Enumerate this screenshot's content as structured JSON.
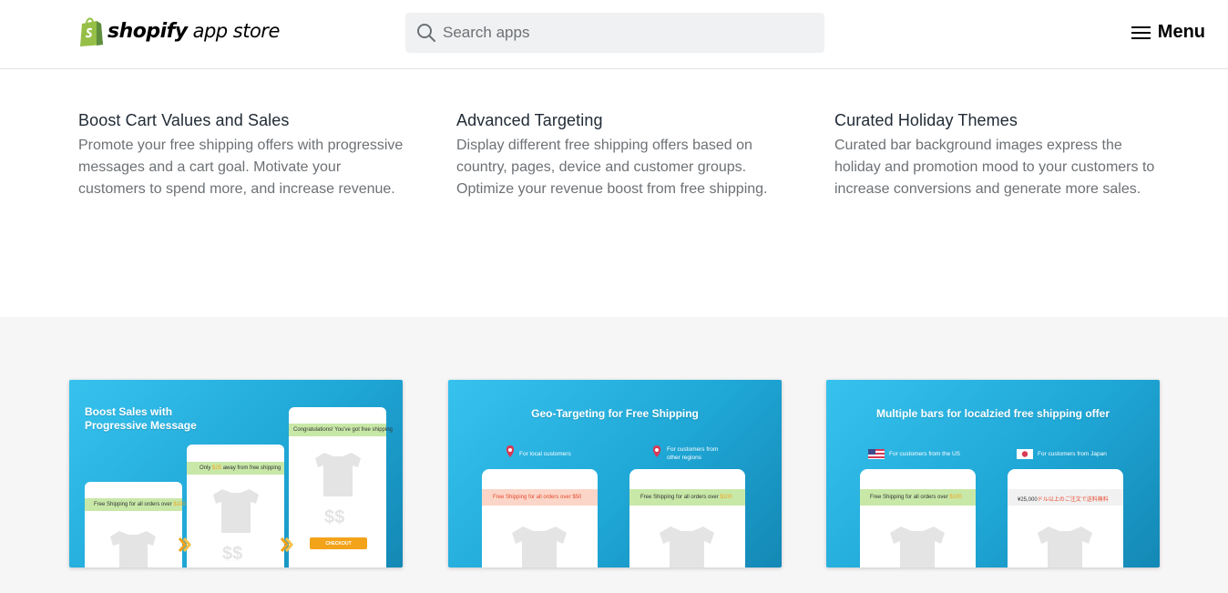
{
  "header": {
    "logo_word": "shopify",
    "logo_sub": "app store",
    "search_placeholder": "Search apps",
    "menu_label": "Menu"
  },
  "features": [
    {
      "title": "Boost Cart Values and Sales",
      "description": "Promote your free shipping offers with progressive messages and a cart goal. Motivate your customers to spend more, and increase revenue."
    },
    {
      "title": "Advanced Targeting",
      "description": "Display different free shipping offers based on country, pages, device and customer groups. Optimize your revenue boost from free shipping."
    },
    {
      "title": "Curated Holiday Themes",
      "description": "Curated bar background images express the holiday and promotion mood to your customers to increase conversions and generate more sales."
    }
  ],
  "screenshots": [
    {
      "title_line1": "Boost Sales with",
      "title_line2": "Progressive Message",
      "phone1_bar_pre": "Free Shipping for all orders over ",
      "phone1_bar_amount": "$100",
      "phone2_bar_pre": "Only ",
      "phone2_bar_amount": "$25",
      "phone2_bar_post": " away from free shipping",
      "phone3_bar": "Congratulations! You've got free shipping",
      "price_label": "$$",
      "checkout_label": "CHECKOUT"
    },
    {
      "title": "Geo-Targeting for Free Shipping",
      "pin1_label": "For local customers",
      "pin2_label_line1": "For customers from",
      "pin2_label_line2": "other regions",
      "phone1_bar": "Free Shipping for all orders over $50",
      "phone2_bar_pre": "Free Shipping for all orders over ",
      "phone2_bar_amount": "$100"
    },
    {
      "title": "Multiple bars for localzied free shipping offer",
      "flag1_label": "For customers from the US",
      "flag2_label": "For customers from Japan",
      "phone1_bar_pre": "Free Shipping for all orders over ",
      "phone1_bar_amount": "$100",
      "phone2_bar_pre": "¥25,000",
      "phone2_bar_post": "ドル以上のご注文で送料無料"
    }
  ],
  "colors": {
    "brand_green": "#95bf47",
    "card_blue": "#1fa7d6",
    "accent_orange": "#f3a31a",
    "accent_red": "#e8492f"
  }
}
